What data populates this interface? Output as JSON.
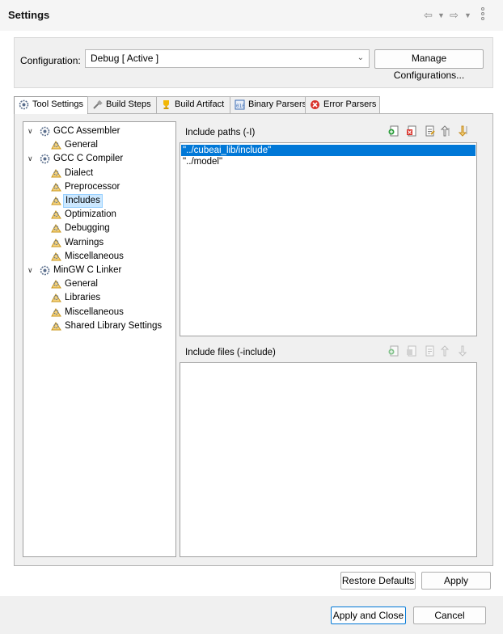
{
  "window": {
    "title": "Settings"
  },
  "nav": {
    "back": "⇦",
    "forward": "⇨",
    "dropdown": "▼"
  },
  "configuration": {
    "label": "Configuration:",
    "value": "Debug  [ Active ]",
    "manage_button": "Manage Configurations..."
  },
  "tabs": [
    {
      "label": "Tool Settings",
      "icon": "gear-icon",
      "active": true
    },
    {
      "label": "Build Steps",
      "icon": "hammer-icon"
    },
    {
      "label": "Build Artifact",
      "icon": "trophy-icon"
    },
    {
      "label": "Binary Parsers",
      "icon": "binary-icon"
    },
    {
      "label": "Error Parsers",
      "icon": "error-icon"
    }
  ],
  "tree": [
    {
      "label": "GCC Assembler",
      "level": 0,
      "expanded": true
    },
    {
      "label": "General",
      "level": 1
    },
    {
      "label": "GCC C Compiler",
      "level": 0,
      "expanded": true
    },
    {
      "label": "Dialect",
      "level": 1
    },
    {
      "label": "Preprocessor",
      "level": 1
    },
    {
      "label": "Includes",
      "level": 1,
      "selected": true
    },
    {
      "label": "Optimization",
      "level": 1
    },
    {
      "label": "Debugging",
      "level": 1
    },
    {
      "label": "Warnings",
      "level": 1
    },
    {
      "label": "Miscellaneous",
      "level": 1
    },
    {
      "label": "MinGW C Linker",
      "level": 0,
      "expanded": true
    },
    {
      "label": "General",
      "level": 1
    },
    {
      "label": "Libraries",
      "level": 1
    },
    {
      "label": "Miscellaneous",
      "level": 1
    },
    {
      "label": "Shared Library Settings",
      "level": 1
    }
  ],
  "include_paths": {
    "title": "Include paths (-I)",
    "items": [
      "\"../cubeai_lib/include\"",
      "\"../model\""
    ],
    "selected_index": 0
  },
  "include_files": {
    "title": "Include files (-include)",
    "items": []
  },
  "buttons": {
    "restore_defaults": "Restore Defaults",
    "apply": "Apply",
    "apply_and_close": "Apply and Close",
    "cancel": "Cancel"
  }
}
